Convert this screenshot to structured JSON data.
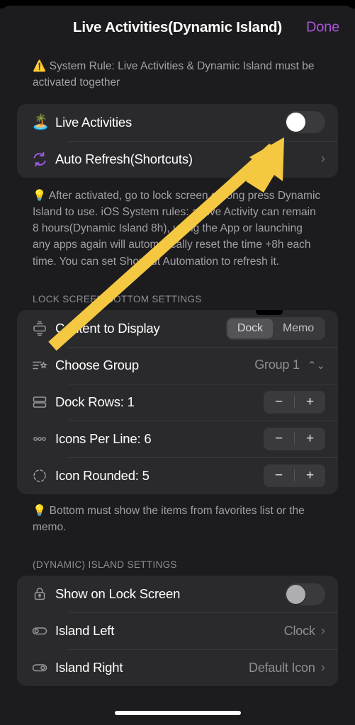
{
  "header": {
    "title": "Live Activities(Dynamic Island)",
    "done_label": "Done",
    "done_color": "#a855d8"
  },
  "warning_note": {
    "icon": "warning-triangle",
    "text": "System Rule: Live Activities & Dynamic Island must be activated together"
  },
  "activities_card": {
    "rows": [
      {
        "icon": "island-emoji",
        "label": "Live Activities",
        "control": "toggle",
        "value": "off"
      },
      {
        "icon": "refresh-icon",
        "label": "Auto Refresh(Shortcuts)",
        "control": "chevron",
        "value": ""
      }
    ]
  },
  "info_note": {
    "icon": "lightbulb",
    "text": "After activated, go to lock screen or long press Dynamic Island to use. iOS System rules: a Live Activity can remain 8 hours(Dynamic Island 8h), using the App or launching any apps again will automatically reset the time +8h each time. You can set Shortcut Automation to refresh it."
  },
  "lock_screen_section": {
    "header": "LOCK SCREEN BOTTOM SETTINGS",
    "content_row": {
      "icon": "display-icon",
      "label": "Content to Display",
      "options": [
        "Dock",
        "Memo"
      ],
      "selected": "Dock"
    },
    "group_row": {
      "icon": "list-star-icon",
      "label": "Choose Group",
      "value": "Group 1",
      "indicator": "up-down-chevron"
    },
    "stepper_rows": [
      {
        "icon": "rows-icon",
        "label": "Dock Rows: 1",
        "minus": "−",
        "plus": "+"
      },
      {
        "icon": "dots-icon",
        "label": "Icons Per Line: 6",
        "minus": "−",
        "plus": "+"
      },
      {
        "icon": "dashed-circle-icon",
        "label": "Icon Rounded: 5",
        "minus": "−",
        "plus": "+"
      }
    ]
  },
  "bottom_note": {
    "icon": "lightbulb",
    "text": "Bottom must show the items from favorites list or the memo."
  },
  "island_section": {
    "header": "(DYNAMIC) ISLAND SETTINGS",
    "rows": [
      {
        "icon": "lock-icon",
        "label": "Show on Lock Screen",
        "control": "toggle",
        "value": "off"
      },
      {
        "icon": "toggle-left-icon",
        "label": "Island Left",
        "control": "chevron",
        "value": "Clock"
      },
      {
        "icon": "toggle-right-icon",
        "label": "Island Right",
        "control": "chevron",
        "value": "Default Icon"
      }
    ]
  },
  "annotation": {
    "type": "arrow",
    "color": "#f5c842",
    "points_to": "Live Activities toggle"
  }
}
